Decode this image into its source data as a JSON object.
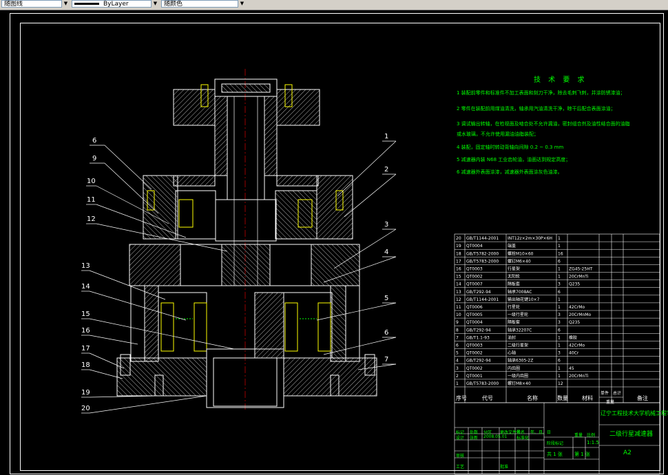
{
  "toolbar": {
    "layer_value": "随图线",
    "linetype_value": "ByLayer",
    "color_value": "随颜色"
  },
  "callouts": [
    "1",
    "2",
    "3",
    "4",
    "5",
    "6",
    "7",
    "6",
    "9",
    "10",
    "11",
    "12",
    "13",
    "14",
    "15",
    "16",
    "17",
    "18",
    "19",
    "20"
  ],
  "tech_requirements": {
    "title": "技 术 要 求",
    "lines": [
      "1 装配前零件和标准件不加工表面和刻刀干净，除去毛刺飞刺，并涂防锈漆油；",
      "2 零件在装配前用煤油清洗，轴承用汽油清洗干净，晾干后配合表面涂油；",
      "3 调试输出转轴，在检视面及啮合处不允许漏油，密封组合剂及油性结合面的油脂",
      "   或水玻璃，不允许使用漏油油脂装配；",
      "4 装配，固定轴时转动背轴向间隙 0.2 ~ 0.3 mm",
      "5 减速器内装 N68 工业齿轮油，油面达到规定高度；",
      "6 减速器外表面涂漆，减速器外表面涂灰色油漆。"
    ]
  },
  "bom": {
    "rows": [
      [
        "20",
        "GB/T1144-2001",
        "INT12z×2m×30P×6H",
        "1",
        "",
        ""
      ],
      [
        "19",
        "QT0004",
        "端盖",
        "1",
        "",
        ""
      ],
      [
        "18",
        "GB/T5782-2000",
        "螺栓M10×60",
        "16",
        "",
        ""
      ],
      [
        "17",
        "GB/T5783-2000",
        "螺钉M6×40",
        "6",
        "",
        ""
      ],
      [
        "16",
        "QT0003",
        "行星架",
        "1",
        "ZG45-25HT",
        ""
      ],
      [
        "15",
        "QT0002",
        "太阳轮",
        "1",
        "20CrMnTi",
        ""
      ],
      [
        "14",
        "QT0007",
        "隔板套",
        "3",
        "Q235",
        ""
      ],
      [
        "13",
        "GB/T292-94",
        "轴承7008AC",
        "6",
        "",
        ""
      ],
      [
        "12",
        "GB/T1144-2001",
        "输出轴花键10×7",
        "1",
        "",
        ""
      ],
      [
        "11",
        "QT0006",
        "行星轮",
        "1",
        "42CrMo",
        ""
      ],
      [
        "10",
        "QT0005",
        "一级行星轮",
        "3",
        "20CrMnMo",
        ""
      ],
      [
        "9",
        "QT0004",
        "隔板套",
        "3",
        "Q235",
        ""
      ],
      [
        "8",
        "GB/T292-94",
        "轴承32207C",
        "6",
        "",
        ""
      ],
      [
        "7",
        "GB/T1.1-93",
        "油封",
        "1",
        "橡胶",
        ""
      ],
      [
        "6",
        "QT0003",
        "二级行星架",
        "1",
        "42CrMo",
        ""
      ],
      [
        "5",
        "QT0002",
        "心轴",
        "3",
        "40Cr",
        ""
      ],
      [
        "4",
        "GB/T292-94",
        "轴承6305-2Z",
        "6",
        "",
        ""
      ],
      [
        "3",
        "QT0002",
        "内齿圈",
        "1",
        "45",
        ""
      ],
      [
        "2",
        "QT0001",
        "一级内齿圈",
        "1",
        "20CrMnTi",
        ""
      ],
      [
        "1",
        "GB/T5783-2000",
        "螺钉M8×40",
        "12",
        "",
        ""
      ]
    ],
    "header": {
      "no": "序号",
      "code": "代号",
      "name": "名称",
      "qty": "数量",
      "material": "材料",
      "unit_weight": "单件",
      "total_weight": "总计",
      "weight": "重量",
      "remark": "备注"
    }
  },
  "title_block": {
    "school": "辽宁工程技术大学机械工程学院",
    "drawing_name": "二级行星减速器",
    "drawing_no": "A2",
    "scale": "1:1.5",
    "sheet_total_label": "共  1  张",
    "sheet_label": "第  1  张",
    "labels": {
      "marks": "标记",
      "count": "处数",
      "zone": "分区",
      "doc_no": "更改文件号",
      "sign": "签名",
      "date": "年、月、日",
      "design": "设计",
      "standard": "标准化",
      "stage": "阶段标记",
      "weight": "重量",
      "scale": "比例",
      "review": "审核",
      "process": "工艺",
      "approve": "批准",
      "design_date": "2008.05.01",
      "design_name": "张新"
    }
  },
  "colors": {
    "background": "#000000",
    "line": "#ffffff",
    "text": "#00ff00",
    "accent": "#ffff00",
    "hatch": "#ffffff",
    "bearing": "#ffff00"
  }
}
